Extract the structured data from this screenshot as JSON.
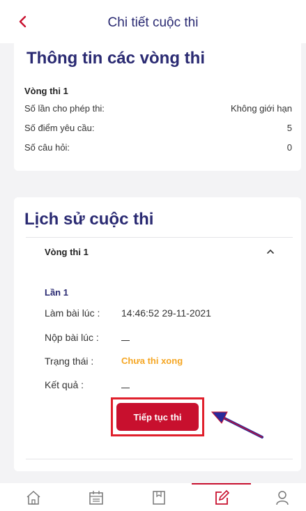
{
  "header": {
    "title": "Chi tiết cuộc thi"
  },
  "rounds_info": {
    "heading": "Thông tin các vòng thi",
    "round_name": "Vòng thi 1",
    "rows": [
      {
        "label": "Số lần cho phép thi:",
        "value": "Không giới hạn"
      },
      {
        "label": "Số điểm yêu cầu:",
        "value": "5"
      },
      {
        "label": "Số câu hỏi:",
        "value": "0"
      }
    ]
  },
  "history": {
    "heading": "Lịch sử cuộc thi",
    "accordion_title": "Vòng thi 1",
    "attempt": "Lần 1",
    "started_label": "Làm bài lúc :",
    "started_value": "14:46:52 29-11-2021",
    "submitted_label": "Nộp bài lúc :",
    "status_label": "Trạng thái :",
    "status_value": "Chưa thi xong",
    "result_label": "Kết quả :",
    "continue_button": "Tiếp tục thi"
  },
  "colors": {
    "accent": "#c8102e",
    "heading": "#2a2a72",
    "status": "#f5a623"
  },
  "bottom_nav": {
    "items": [
      "home-icon",
      "calendar-icon",
      "book-icon",
      "edit-icon",
      "user-icon"
    ],
    "active": "edit-icon"
  }
}
